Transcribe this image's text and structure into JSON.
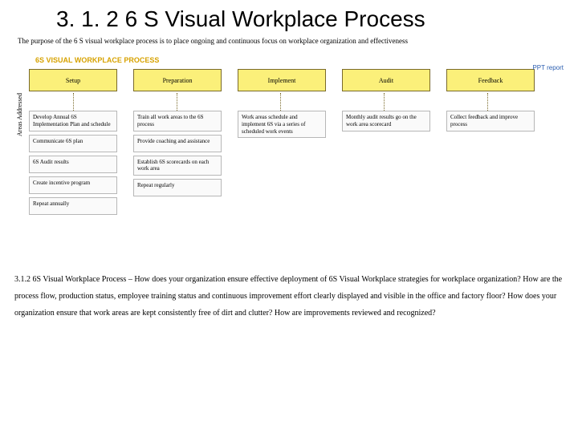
{
  "title": "3. 1. 2 6 S Visual Workplace Process",
  "purpose": "The purpose of the 6 S visual workplace process is to place ongoing and continuous focus on workplace organization and effectiveness",
  "process_title": "6S VISUAL WORKPLACE PROCESS",
  "ppt_tag": "PPT report",
  "areas_label": "Areas Addressed",
  "stages": [
    "Setup",
    "Preparation",
    "Implement",
    "Audit",
    "Feedback"
  ],
  "columns": [
    [
      "Develop Annual 6S Implementation Plan and schedule",
      "Communicate 6S plan",
      "6S Audit results",
      "Create incentive program",
      "Repeat annually"
    ],
    [
      "Train all work areas to the 6S process",
      "Provide coaching and assistance",
      "Establish 6S scorecards on each work area",
      "Repeat regularly"
    ],
    [
      "Work areas schedule and implement 6S via a series of scheduled work events"
    ],
    [
      "Monthly audit results go on the work area scorecard"
    ],
    [
      "Collect feedback and improve process"
    ]
  ],
  "bottom_text": "3.1.2 6S Visual Workplace Process – How does your organization ensure effective deployment of 6S Visual Workplace strategies for workplace organization? How are the process flow, production status, employee training status and continuous improvement effort clearly displayed and visible in the office and factory floor? How does your organization ensure that work areas are kept consistently free of dirt and clutter? How are improvements reviewed and recognized?"
}
